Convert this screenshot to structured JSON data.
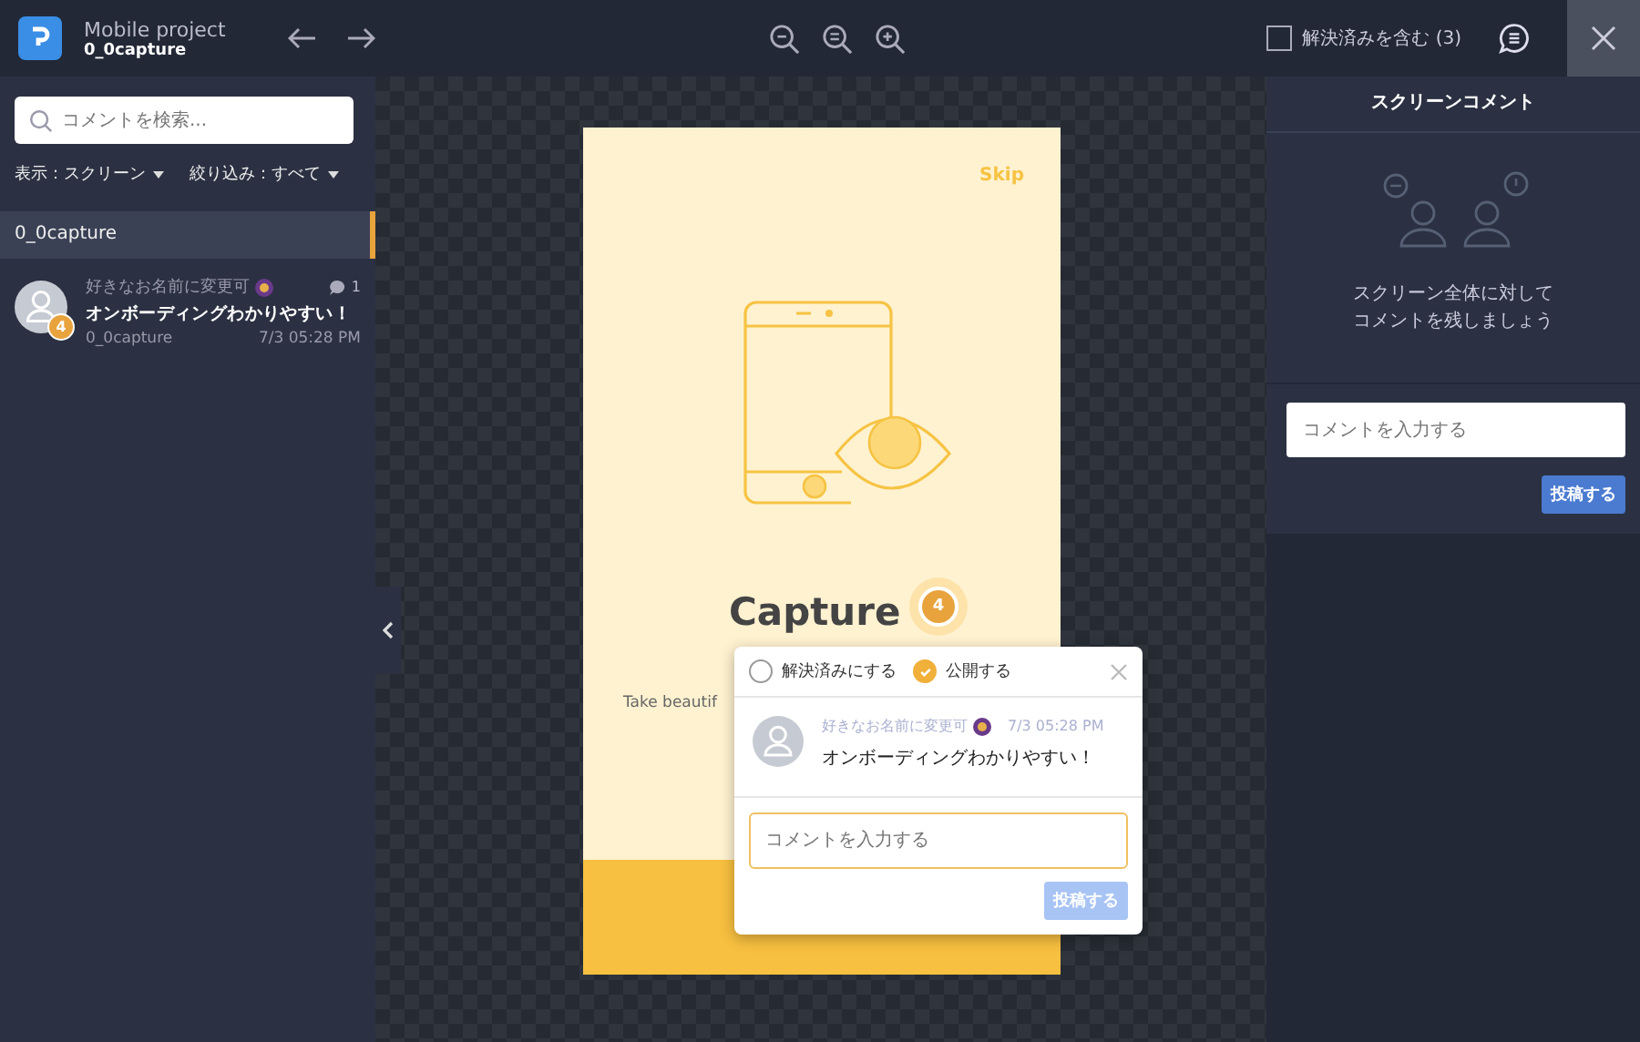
{
  "header": {
    "project": "Mobile project",
    "screen": "0_0capture"
  },
  "include_resolved": {
    "label": "解決済みを含む (3)",
    "checked": false
  },
  "sidebar": {
    "search_placeholder": "コメントを検索...",
    "filters": [
      {
        "label": "表示：スクリーン"
      },
      {
        "label": "絞り込み：すべて"
      }
    ],
    "groups": [
      {
        "title": "0_0capture",
        "selected": true,
        "comments": [
          {
            "author": "好きなお名前に変更可",
            "text": "オンボーディングわかりやすい！",
            "screen": "0_0capture",
            "time": "7/3 05:28 PM",
            "reply_count": "1",
            "marker": "4"
          }
        ]
      }
    ]
  },
  "canvas": {
    "skip": "Skip",
    "title": "Capture",
    "subtitle": "Take beautif",
    "marker": "4",
    "popup": {
      "options": [
        {
          "label": "解決済みにする",
          "checked": false
        },
        {
          "label": "公開する",
          "checked": true
        }
      ],
      "author": "好きなお名前に変更可",
      "time": "7/3 05:28 PM",
      "text": "オンボーディングわかりやすい！",
      "reply_placeholder": "コメントを入力する",
      "submit": "投稿する"
    }
  },
  "right_panel": {
    "title": "スクリーンコメント",
    "empty_message": [
      "スクリーン全体に対して",
      "コメントを残しましょう"
    ],
    "placeholder": "コメントを入力する",
    "submit": "投稿する"
  }
}
